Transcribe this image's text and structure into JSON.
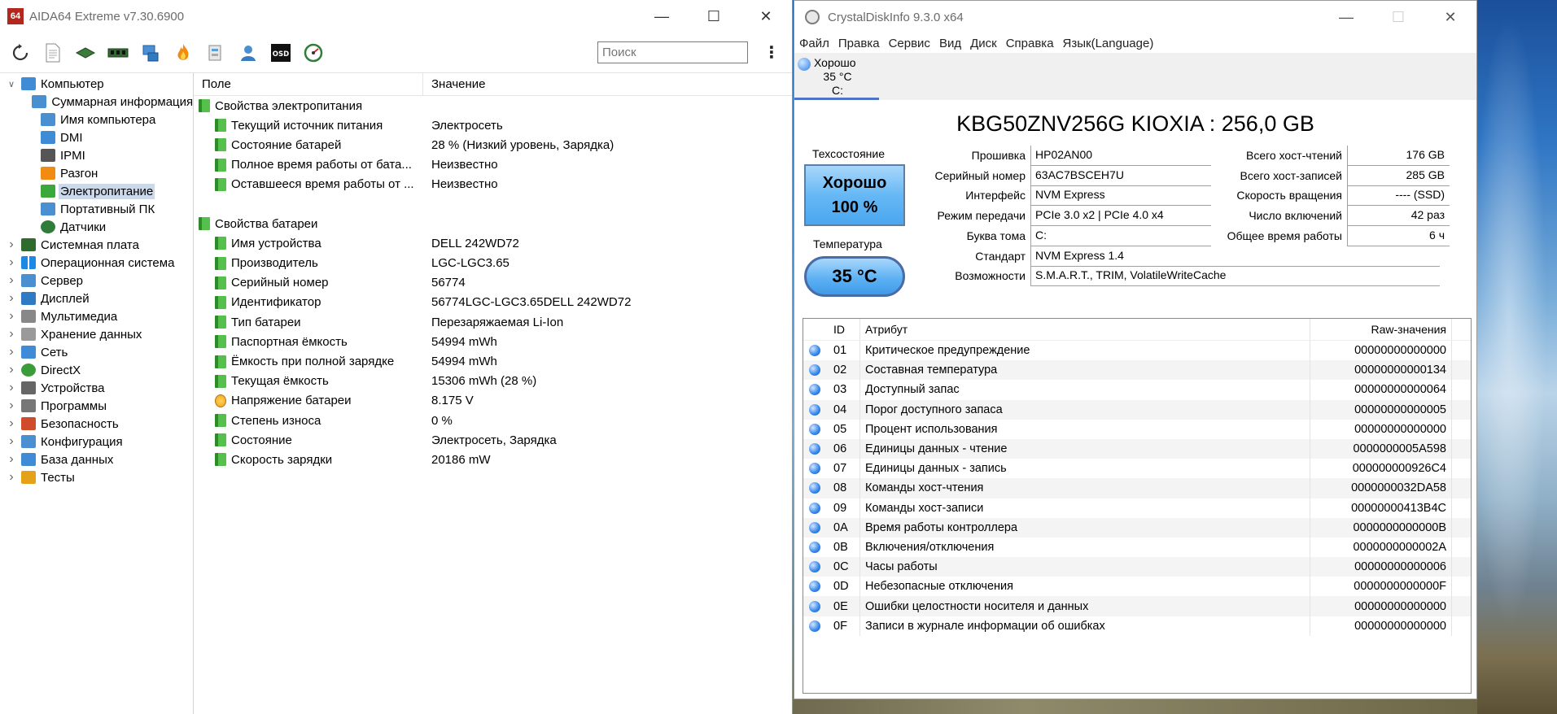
{
  "aida": {
    "title": "AIDA64 Extreme v7.30.6900",
    "logo_text": "64",
    "search_placeholder": "Поиск",
    "menu_glyph": "⋮",
    "tree": [
      {
        "label": "Компьютер",
        "level": 0,
        "expanded": true,
        "icon": "computer-icon"
      },
      {
        "label": "Суммарная информация",
        "level": 1,
        "icon": "summary-icon"
      },
      {
        "label": "Имя компьютера",
        "level": 1,
        "icon": "computer-name-icon"
      },
      {
        "label": "DMI",
        "level": 1,
        "icon": "dmi-icon"
      },
      {
        "label": "IPMI",
        "level": 1,
        "icon": "ipmi-icon"
      },
      {
        "label": "Разгон",
        "level": 1,
        "icon": "overclock-icon"
      },
      {
        "label": "Электропитание",
        "level": 1,
        "icon": "power-icon",
        "selected": true
      },
      {
        "label": "Портативный ПК",
        "level": 1,
        "icon": "laptop-icon"
      },
      {
        "label": "Датчики",
        "level": 1,
        "icon": "sensor-icon"
      },
      {
        "label": "Системная плата",
        "level": 0,
        "icon": "motherboard-icon"
      },
      {
        "label": "Операционная система",
        "level": 0,
        "icon": "windows-icon"
      },
      {
        "label": "Сервер",
        "level": 0,
        "icon": "server-icon"
      },
      {
        "label": "Дисплей",
        "level": 0,
        "icon": "display-icon"
      },
      {
        "label": "Мультимедиа",
        "level": 0,
        "icon": "multimedia-icon"
      },
      {
        "label": "Хранение данных",
        "level": 0,
        "icon": "storage-icon"
      },
      {
        "label": "Сеть",
        "level": 0,
        "icon": "network-icon"
      },
      {
        "label": "DirectX",
        "level": 0,
        "icon": "directx-icon"
      },
      {
        "label": "Устройства",
        "level": 0,
        "icon": "devices-icon"
      },
      {
        "label": "Программы",
        "level": 0,
        "icon": "programs-icon"
      },
      {
        "label": "Безопасность",
        "level": 0,
        "icon": "security-icon"
      },
      {
        "label": "Конфигурация",
        "level": 0,
        "icon": "config-icon"
      },
      {
        "label": "База данных",
        "level": 0,
        "icon": "database-icon"
      },
      {
        "label": "Тесты",
        "level": 0,
        "icon": "benchmark-icon"
      }
    ],
    "grid": {
      "col_field": "Поле",
      "col_value": "Значение",
      "rows": [
        {
          "type": "group",
          "field": "Свойства электропитания",
          "value": ""
        },
        {
          "type": "item",
          "field": "Текущий источник питания",
          "value": "Электросеть"
        },
        {
          "type": "item",
          "field": "Состояние батарей",
          "value": "28 % (Низкий уровень, Зарядка)"
        },
        {
          "type": "item",
          "field": "Полное время работы от бата...",
          "value": "Неизвестно"
        },
        {
          "type": "item",
          "field": "Оставшееся время работы от ...",
          "value": "Неизвестно"
        },
        {
          "type": "gap"
        },
        {
          "type": "group",
          "field": "Свойства батареи",
          "value": ""
        },
        {
          "type": "item",
          "field": "Имя устройства",
          "value": "DELL 242WD72"
        },
        {
          "type": "item",
          "field": "Производитель",
          "value": "LGC-LGC3.65"
        },
        {
          "type": "item",
          "field": "Серийный номер",
          "value": "56774"
        },
        {
          "type": "item",
          "field": "Идентификатор",
          "value": "56774LGC-LGC3.65DELL 242WD72"
        },
        {
          "type": "item",
          "field": "Тип батареи",
          "value": "Перезаряжаемая Li-Ion"
        },
        {
          "type": "item",
          "field": "Паспортная ёмкость",
          "value": "54994 mWh"
        },
        {
          "type": "item",
          "field": "Ёмкость при полной зарядке",
          "value": "54994 mWh"
        },
        {
          "type": "item",
          "field": "Текущая ёмкость",
          "value": "15306 mWh  (28 %)"
        },
        {
          "type": "item",
          "field": "Напряжение батареи",
          "value": "8.175 V",
          "icon": "bolt"
        },
        {
          "type": "item",
          "field": "Степень износа",
          "value": "0 %"
        },
        {
          "type": "item",
          "field": "Состояние",
          "value": "Электросеть, Зарядка"
        },
        {
          "type": "item",
          "field": "Скорость зарядки",
          "value": "20186 mW"
        }
      ]
    }
  },
  "cdi": {
    "title": "CrystalDiskInfo 9.3.0 x64",
    "menu": [
      "Файл",
      "Правка",
      "Сервис",
      "Вид",
      "Диск",
      "Справка",
      "Язык(Language)"
    ],
    "tab": {
      "status": "Хорошо",
      "temp": "35 °C",
      "drive": "C:"
    },
    "disk_title": "KBG50ZNV256G KIOXIA : 256,0 GB",
    "health_label": "Техсостояние",
    "health_status": "Хорошо",
    "health_percent": "100 %",
    "temp_label": "Температура",
    "temp_value": "35 °C",
    "fields": [
      {
        "label": "Прошивка",
        "value": "HP02AN00"
      },
      {
        "label": "Серийный номер",
        "value": "63AC7BSCEH7U"
      },
      {
        "label": "Интерфейс",
        "value": "NVM Express"
      },
      {
        "label": "Режим передачи",
        "value": "PCIe 3.0 x2 | PCIe 4.0 x4"
      },
      {
        "label": "Буква тома",
        "value": "C:"
      },
      {
        "label": "Стандарт",
        "value": "NVM Express 1.4"
      },
      {
        "label": "Возможности",
        "value": "S.M.A.R.T., TRIM, VolatileWriteCache"
      }
    ],
    "right_fields": [
      {
        "label": "Всего хост-чтений",
        "value": "176 GB"
      },
      {
        "label": "Всего хост-записей",
        "value": "285 GB"
      },
      {
        "label": "Скорость вращения",
        "value": "---- (SSD)"
      },
      {
        "label": "Число включений",
        "value": "42 раз"
      },
      {
        "label": "Общее время работы",
        "value": "6 ч"
      }
    ],
    "attr_head": {
      "id": "ID",
      "attr": "Атрибут",
      "raw": "Raw-значения"
    },
    "attributes": [
      {
        "id": "01",
        "name": "Критическое предупреждение",
        "raw": "00000000000000"
      },
      {
        "id": "02",
        "name": "Составная температура",
        "raw": "00000000000134"
      },
      {
        "id": "03",
        "name": "Доступный запас",
        "raw": "00000000000064"
      },
      {
        "id": "04",
        "name": "Порог доступного запаса",
        "raw": "00000000000005"
      },
      {
        "id": "05",
        "name": "Процент использования",
        "raw": "00000000000000"
      },
      {
        "id": "06",
        "name": "Единицы данных - чтение",
        "raw": "0000000005A598"
      },
      {
        "id": "07",
        "name": "Единицы данных - запись",
        "raw": "000000000926C4"
      },
      {
        "id": "08",
        "name": "Команды хост-чтения",
        "raw": "0000000032DA58"
      },
      {
        "id": "09",
        "name": "Команды хост-записи",
        "raw": "00000000413B4C"
      },
      {
        "id": "0A",
        "name": "Время работы контроллера",
        "raw": "0000000000000B"
      },
      {
        "id": "0B",
        "name": "Включения/отключения",
        "raw": "0000000000002A"
      },
      {
        "id": "0C",
        "name": "Часы работы",
        "raw": "00000000000006"
      },
      {
        "id": "0D",
        "name": "Небезопасные отключения",
        "raw": "0000000000000F"
      },
      {
        "id": "0E",
        "name": "Ошибки целостности носителя и данных",
        "raw": "00000000000000"
      },
      {
        "id": "0F",
        "name": "Записи в журнале информации об ошибках",
        "raw": "00000000000000"
      }
    ]
  }
}
